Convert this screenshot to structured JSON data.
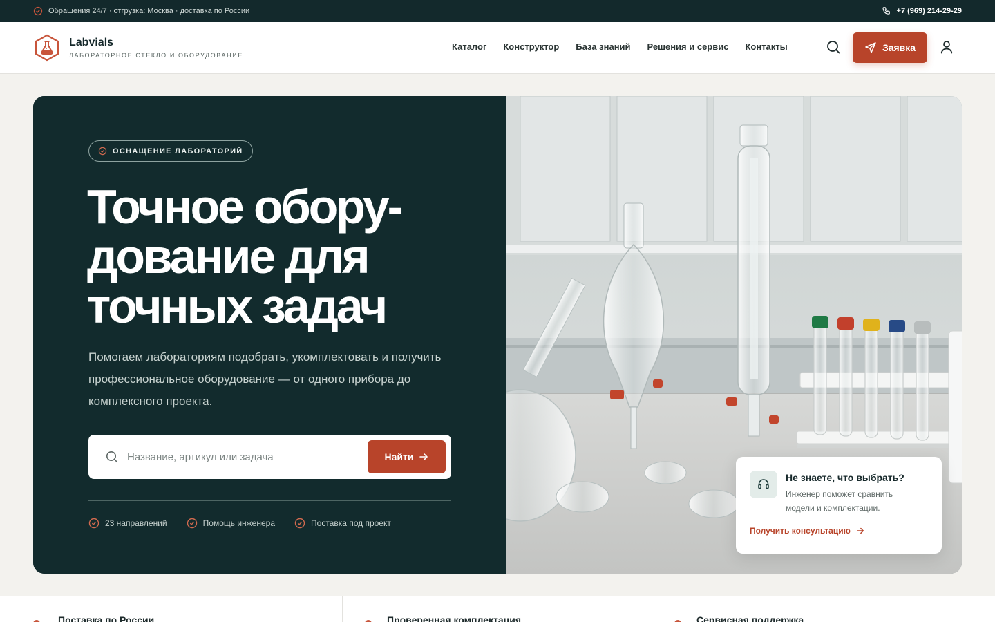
{
  "topbar": {
    "info": "Обращения 24/7 · отгрузка: Москва · доставка по России",
    "phone": "+7 (969) 214-29-29"
  },
  "header": {
    "brand_name": "Labvials",
    "brand_tagline": "Лабораторное стекло и оборудование",
    "nav": [
      "Каталог",
      "Конструктор",
      "База знаний",
      "Решения и сервис",
      "Контакты"
    ],
    "cta_label": "Заявка"
  },
  "hero": {
    "badge": "ОСНАЩЕНИЕ ЛАБОРАТОРИЙ",
    "headline_lines": [
      "Точное обору-",
      "дование для",
      "точных задач"
    ],
    "lead": "Помогаем лабораториям подобрать, укомплектовать и получить профессиональное оборудование — от одного прибора до комплексного проекта.",
    "search": {
      "placeholder": "Название, артикул или задача",
      "button_label": "Найти"
    },
    "features": [
      "23 направлений",
      "Помощь инженера",
      "Поставка под проект"
    ],
    "consult": {
      "title": "Не знаете, что выбрать?",
      "text": "Инженер поможет сравнить модели и комплектации.",
      "link": "Получить консультацию"
    }
  },
  "strip": {
    "items": [
      "Поставка по России",
      "Проверенная комплектация",
      "Сервисная поддержка"
    ]
  },
  "colors": {
    "accent": "#b8442a",
    "dark": "#122b2d",
    "topbar": "#13292c"
  }
}
